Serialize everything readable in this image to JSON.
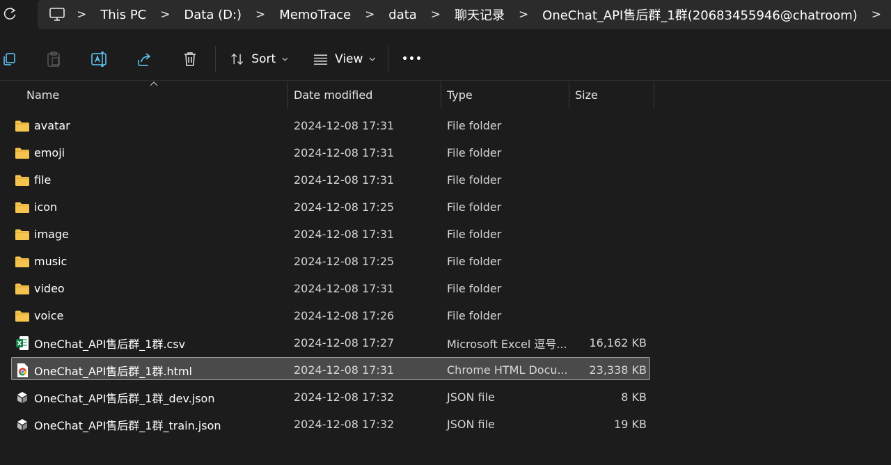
{
  "addressbar": {
    "breadcrumbs": [
      "This PC",
      "Data (D:)",
      "MemoTrace",
      "data",
      "聊天记录",
      "OneChat_API售后群_1群(20683455946@chatroom)"
    ],
    "separator": ">"
  },
  "toolbar": {
    "sort_label": "Sort",
    "view_label": "View",
    "more_label": "•••"
  },
  "columns": {
    "name": "Name",
    "date": "Date modified",
    "type": "Type",
    "size": "Size"
  },
  "files": [
    {
      "name": "avatar",
      "date": "2024-12-08 17:31",
      "type": "File folder",
      "size": "",
      "icon": "folder-icon"
    },
    {
      "name": "emoji",
      "date": "2024-12-08 17:31",
      "type": "File folder",
      "size": "",
      "icon": "folder-icon"
    },
    {
      "name": "file",
      "date": "2024-12-08 17:31",
      "type": "File folder",
      "size": "",
      "icon": "folder-icon"
    },
    {
      "name": "icon",
      "date": "2024-12-08 17:25",
      "type": "File folder",
      "size": "",
      "icon": "folder-icon"
    },
    {
      "name": "image",
      "date": "2024-12-08 17:31",
      "type": "File folder",
      "size": "",
      "icon": "folder-icon"
    },
    {
      "name": "music",
      "date": "2024-12-08 17:25",
      "type": "File folder",
      "size": "",
      "icon": "folder-icon"
    },
    {
      "name": "video",
      "date": "2024-12-08 17:31",
      "type": "File folder",
      "size": "",
      "icon": "folder-icon"
    },
    {
      "name": "voice",
      "date": "2024-12-08 17:26",
      "type": "File folder",
      "size": "",
      "icon": "folder-icon"
    },
    {
      "name": "OneChat_API售后群_1群.csv",
      "date": "2024-12-08 17:27",
      "type": "Microsoft Excel 逗号...",
      "size": "16,162 KB",
      "icon": "excel-csv-icon"
    },
    {
      "name": "OneChat_API售后群_1群.html",
      "date": "2024-12-08 17:31",
      "type": "Chrome HTML Docu...",
      "size": "23,338 KB",
      "icon": "chrome-html-icon"
    },
    {
      "name": "OneChat_API售后群_1群_dev.json",
      "date": "2024-12-08 17:32",
      "type": "JSON file",
      "size": "8 KB",
      "icon": "json-file-icon"
    },
    {
      "name": "OneChat_API售后群_1群_train.json",
      "date": "2024-12-08 17:32",
      "type": "JSON file",
      "size": "19 KB",
      "icon": "json-file-icon"
    }
  ],
  "selected_file": "OneChat_API售后群_1群.html",
  "colors": {
    "background": "#1c1c1c",
    "addressbar": "#2b2b2b",
    "selection": "#4a4a4a",
    "folder": "#f5c44e"
  }
}
